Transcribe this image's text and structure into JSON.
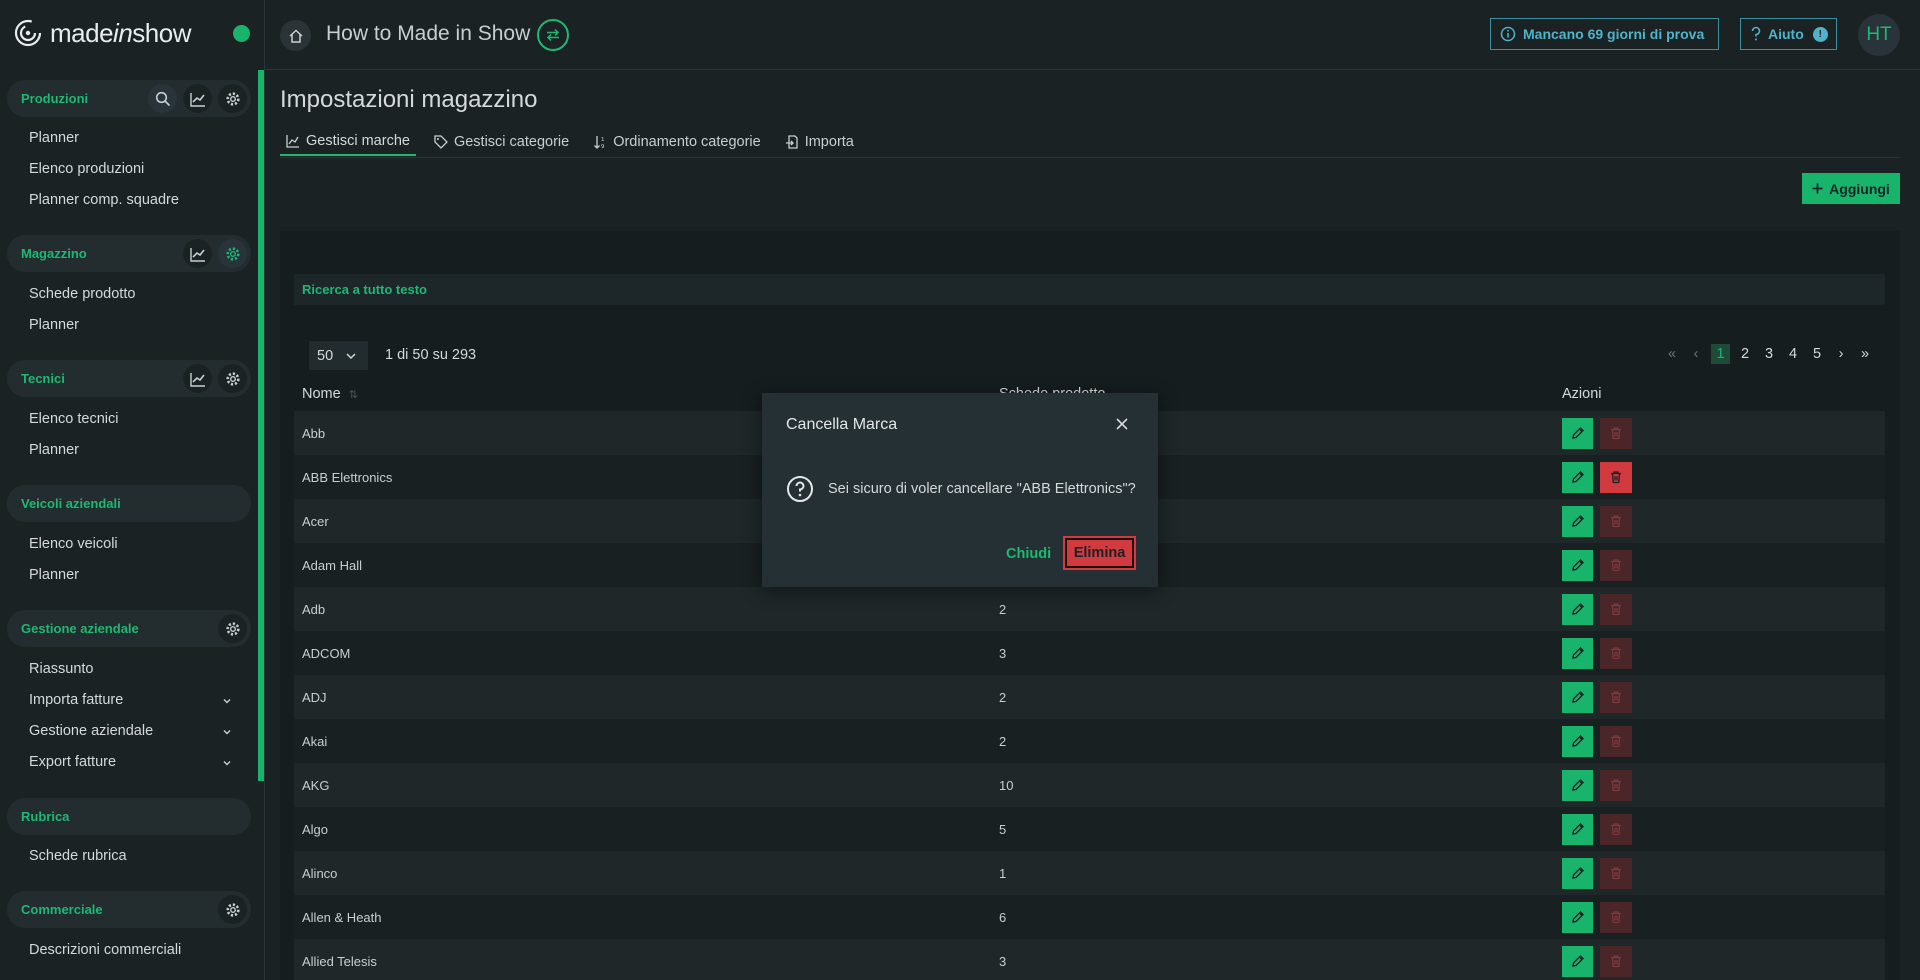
{
  "brand": {
    "name_start": "made",
    "name_mid": "in",
    "name_end": "show"
  },
  "topbar": {
    "app_title": "How to Made in Show",
    "trial_label": "Mancano 69 giorni di prova",
    "help_label": "Aiuto",
    "help_badge": "!",
    "avatar_initials": "HT"
  },
  "sidebar": {
    "sections": [
      {
        "title": "Produzioni",
        "items": [
          "Planner",
          "Elenco produzioni",
          "Planner comp. squadre"
        ]
      },
      {
        "title": "Magazzino",
        "items": [
          "Schede prodotto",
          "Planner"
        ]
      },
      {
        "title": "Tecnici",
        "items": [
          "Elenco tecnici",
          "Planner"
        ]
      },
      {
        "title": "Veicoli aziendali",
        "items": [
          "Elenco veicoli",
          "Planner"
        ]
      },
      {
        "title": "Gestione aziendale",
        "items": [
          "Riassunto",
          "Importa fatture",
          "Gestione aziendale",
          "Export fatture"
        ]
      },
      {
        "title": "Rubrica",
        "items": [
          "Schede rubrica"
        ]
      },
      {
        "title": "Commerciale",
        "items": [
          "Descrizioni commerciali"
        ]
      }
    ]
  },
  "main": {
    "page_title": "Impostazioni magazzino",
    "tabs": [
      "Gestisci marche",
      "Gestisci categorie",
      "Ordinamento categorie",
      "Importa"
    ],
    "add_label": "Aggiungi",
    "search_label": "Ricerca a tutto testo",
    "page_size": "50",
    "range_text": "1 di 50 su 293",
    "pages": [
      "1",
      "2",
      "3",
      "4",
      "5"
    ],
    "columns": {
      "name": "Nome",
      "count": "Schede prodotto",
      "actions": "Azioni"
    },
    "rows": [
      {
        "name": "Abb",
        "count": ""
      },
      {
        "name": "ABB Elettronics",
        "count": ""
      },
      {
        "name": "Acer",
        "count": ""
      },
      {
        "name": "Adam Hall",
        "count": ""
      },
      {
        "name": "Adb",
        "count": "2"
      },
      {
        "name": "ADCOM",
        "count": "3"
      },
      {
        "name": "ADJ",
        "count": "2"
      },
      {
        "name": "Akai",
        "count": "2"
      },
      {
        "name": "AKG",
        "count": "10"
      },
      {
        "name": "Algo",
        "count": "5"
      },
      {
        "name": "Alinco",
        "count": "1"
      },
      {
        "name": "Allen & Heath",
        "count": "6"
      },
      {
        "name": "Allied Telesis",
        "count": "3"
      }
    ]
  },
  "modal": {
    "title": "Cancella Marca",
    "message": "Sei sicuro di voler cancellare \"ABB Elettronics\"?",
    "cancel_label": "Chiudi",
    "confirm_label": "Elimina"
  },
  "colors": {
    "accent": "#18b46b",
    "danger": "#d13a3f",
    "info": "#4fb3c9",
    "bg": "#1b2224"
  }
}
